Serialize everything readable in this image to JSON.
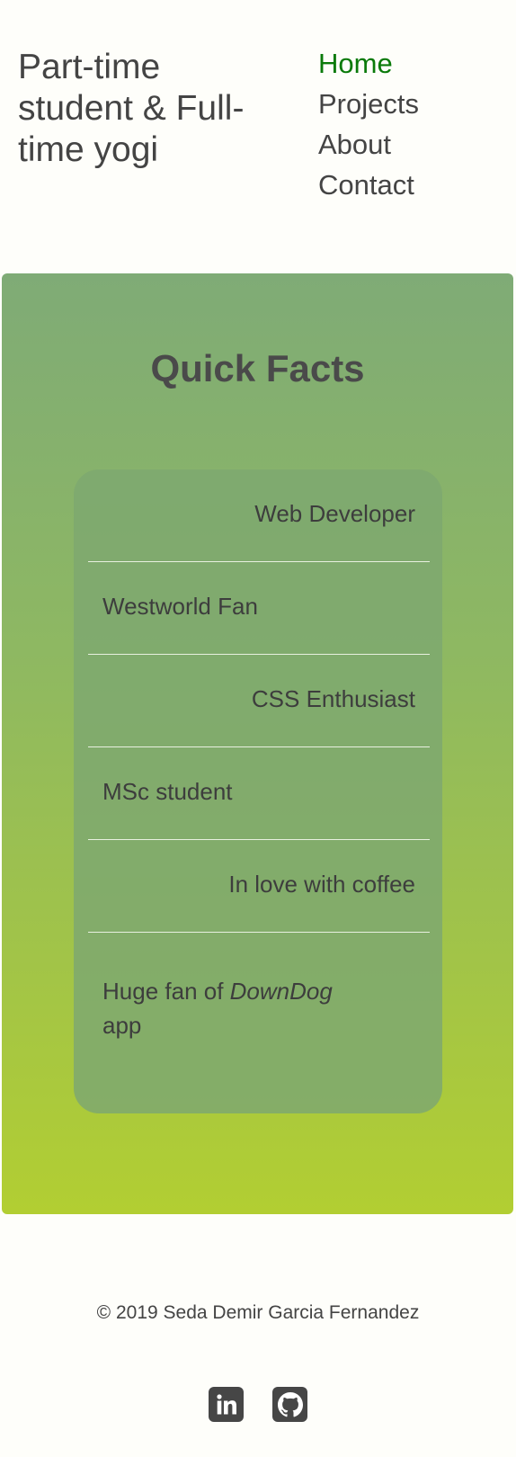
{
  "header": {
    "tagline": "Part-time student & Full-time yogi"
  },
  "nav": {
    "items": [
      {
        "label": "Home",
        "active": true
      },
      {
        "label": "Projects"
      },
      {
        "label": "About"
      },
      {
        "label": "Contact"
      }
    ],
    "active_color": "#0a7a0a"
  },
  "quick_facts": {
    "title": "Quick Facts",
    "items": [
      "Web Developer",
      "Westworld Fan",
      "CSS Enthusiast",
      "MSc student",
      "In love with coffee"
    ],
    "last_item": {
      "prefix": "Huge fan of ",
      "emphasis": "DownDog",
      "suffix": " app"
    }
  },
  "footer": {
    "copyright": "© 2019 Seda Demir Garcia Fernandez",
    "social": [
      "linkedin-icon",
      "github-icon"
    ]
  }
}
